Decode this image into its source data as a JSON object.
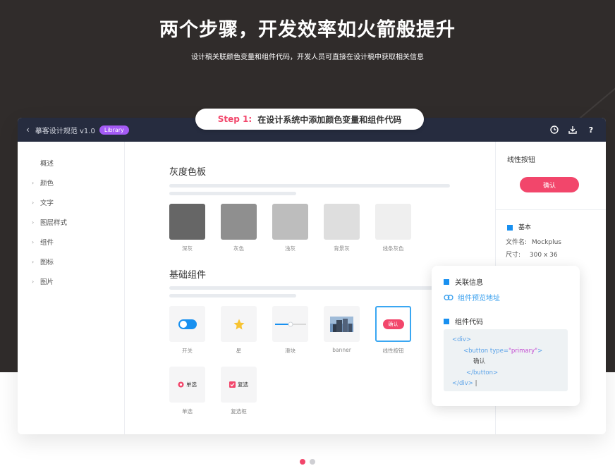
{
  "hero": {
    "title": "两个步骤，开发效率如火箭般提升",
    "subtitle": "设计稿关联颜色变量和组件代码，开发人员可直接在设计稿中获取相关信息"
  },
  "step": {
    "label": "Step 1:",
    "text": "在设计系统中添加颜色变量和组件代码"
  },
  "titlebar": {
    "title": "摹客设计规范 v1.0",
    "badge": "Library"
  },
  "sidebar": {
    "items": [
      {
        "label": "概述",
        "expandable": false
      },
      {
        "label": "颜色",
        "expandable": true
      },
      {
        "label": "文字",
        "expandable": true
      },
      {
        "label": "图层样式",
        "expandable": true
      },
      {
        "label": "组件",
        "expandable": true
      },
      {
        "label": "图标",
        "expandable": true
      },
      {
        "label": "图片",
        "expandable": true
      }
    ]
  },
  "gray_palette": {
    "title": "灰度色板",
    "swatches": [
      {
        "label": "深灰",
        "color": "#666666"
      },
      {
        "label": "灰色",
        "color": "#8f8f8f"
      },
      {
        "label": "浅灰",
        "color": "#bdbdbd"
      },
      {
        "label": "背景灰",
        "color": "#dedede"
      },
      {
        "label": "线条灰色",
        "color": "#efefef"
      }
    ]
  },
  "components": {
    "title": "基础组件",
    "items": [
      {
        "label": "开关"
      },
      {
        "label": "星"
      },
      {
        "label": "滑块"
      },
      {
        "label": "banner"
      },
      {
        "label": "线性按钮",
        "button_text": "确认"
      },
      {
        "label": "单选",
        "control_text": "单选"
      },
      {
        "label": "复选框",
        "control_text": "复选"
      }
    ]
  },
  "right_panel": {
    "title": "线性按钮",
    "button_label": "确认",
    "section": "基本",
    "filename_label": "文件名:",
    "filename": "Mockplus",
    "size_label": "尺寸:",
    "size": "300 x 36"
  },
  "popup": {
    "related_title": "关联信息",
    "preview_link": "组件预览地址",
    "code_title": "组件代码",
    "code": {
      "line1": "<div>",
      "line2_open": "<button type=",
      "line2_val": "\"primary\"",
      "line2_close": ">",
      "line3": "确认",
      "line4": "</button>",
      "line5": "</div>",
      "cursor": "|"
    }
  },
  "colors": {
    "accent": "#f2466b",
    "link_blue": "#3aa0ee",
    "badge_purple": "#a45bf5",
    "titlebar": "#262c3f",
    "hero_bg": "#302c2b"
  },
  "pager": {
    "active_index": 0,
    "count": 2
  }
}
